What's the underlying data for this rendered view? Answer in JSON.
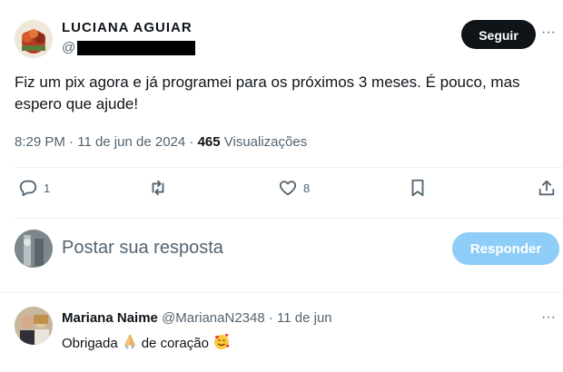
{
  "post": {
    "author_name_partial": "LUCIANA AGUIAR",
    "handle_prefix": "@",
    "follow_label": "Seguir",
    "more_label": "···",
    "text": "Fiz um pix agora e já programei para os próximos 3 meses. É pouco, mas espero que ajude!",
    "time": "8:29 PM",
    "separator": "·",
    "date": "11 de jun de 2024",
    "views_count": "465",
    "views_label": "Visualizações"
  },
  "actions": {
    "reply_count": "1",
    "like_count": "8"
  },
  "composer": {
    "placeholder": "Postar sua resposta",
    "reply_button": "Responder"
  },
  "comment": {
    "name": "Mariana Naime",
    "handle": "@MarianaN2348",
    "separator": "·",
    "date": "11 de jun",
    "more_label": "···",
    "text_before": "Obrigada",
    "text_middle": "de coração"
  }
}
